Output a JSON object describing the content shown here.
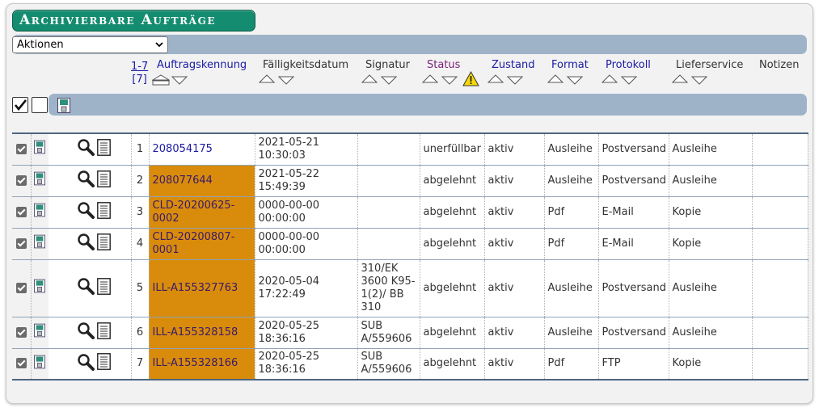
{
  "title": "Archivierbare Aufträge",
  "actions_select": {
    "value": "Aktionen"
  },
  "range": {
    "label": "1-7",
    "count": "[7]"
  },
  "columns": {
    "auftragskennung": "Auftragskennung",
    "faelligkeitsdatum": "Fälligkeitsdatum",
    "signatur": "Signatur",
    "status": "Status",
    "zustand": "Zustand",
    "format": "Format",
    "protokoll": "Protokoll",
    "lieferservice": "Lieferservice",
    "notizen": "Notizen"
  },
  "icons": {
    "sort_asc": "triangle-up-icon",
    "sort_desc": "triangle-down-icon",
    "warning": "warning-icon",
    "save": "save-disk-icon",
    "view": "magnifier-icon",
    "document": "document-icon"
  },
  "colors": {
    "highlight": "#d98c0c",
    "title_bg": "#148c6f",
    "bar": "#9fb3c8",
    "link": "#1a1aa6"
  },
  "rows": [
    {
      "num": "1",
      "id": "208054175",
      "highlight": false,
      "date": "2021-05-21",
      "time": "10:30:03",
      "signatur": "",
      "status": "unerfüllbar",
      "zustand": "aktiv",
      "format": "Ausleihe",
      "protokoll": "Postversand",
      "lieferservice": "Ausleihe",
      "notizen": ""
    },
    {
      "num": "2",
      "id": "208077644",
      "highlight": true,
      "date": "2021-05-22",
      "time": "15:49:39",
      "signatur": "",
      "status": "abgelehnt",
      "zustand": "aktiv",
      "format": "Ausleihe",
      "protokoll": "Postversand",
      "lieferservice": "Ausleihe",
      "notizen": ""
    },
    {
      "num": "3",
      "id": "CLD-20200625-0002",
      "highlight": true,
      "date": "0000-00-00",
      "time": "00:00:00",
      "signatur": "",
      "status": "abgelehnt",
      "zustand": "aktiv",
      "format": "Pdf",
      "protokoll": "E-Mail",
      "lieferservice": "Kopie",
      "notizen": ""
    },
    {
      "num": "4",
      "id": "CLD-20200807-0001",
      "highlight": true,
      "date": "0000-00-00",
      "time": "00:00:00",
      "signatur": "",
      "status": "abgelehnt",
      "zustand": "aktiv",
      "format": "Pdf",
      "protokoll": "E-Mail",
      "lieferservice": "Kopie",
      "notizen": ""
    },
    {
      "num": "5",
      "id": "ILL-A155327763",
      "highlight": true,
      "date": "2020-05-04",
      "time": "17:22:49",
      "signatur": "310/EK 3600 K95-1(2)/ BB 310",
      "status": "abgelehnt",
      "zustand": "aktiv",
      "format": "Ausleihe",
      "protokoll": "Postversand",
      "lieferservice": "Ausleihe",
      "notizen": ""
    },
    {
      "num": "6",
      "id": "ILL-A155328158",
      "highlight": true,
      "date": "2020-05-25",
      "time": "18:36:16",
      "signatur": "SUB A/559606",
      "status": "abgelehnt",
      "zustand": "aktiv",
      "format": "Ausleihe",
      "protokoll": "Postversand",
      "lieferservice": "Ausleihe",
      "notizen": ""
    },
    {
      "num": "7",
      "id": "ILL-A155328166",
      "highlight": true,
      "date": "2020-05-25",
      "time": "18:36:16",
      "signatur": "SUB A/559606",
      "status": "abgelehnt",
      "zustand": "aktiv",
      "format": "Pdf",
      "protokoll": "FTP",
      "lieferservice": "Kopie",
      "notizen": ""
    }
  ]
}
